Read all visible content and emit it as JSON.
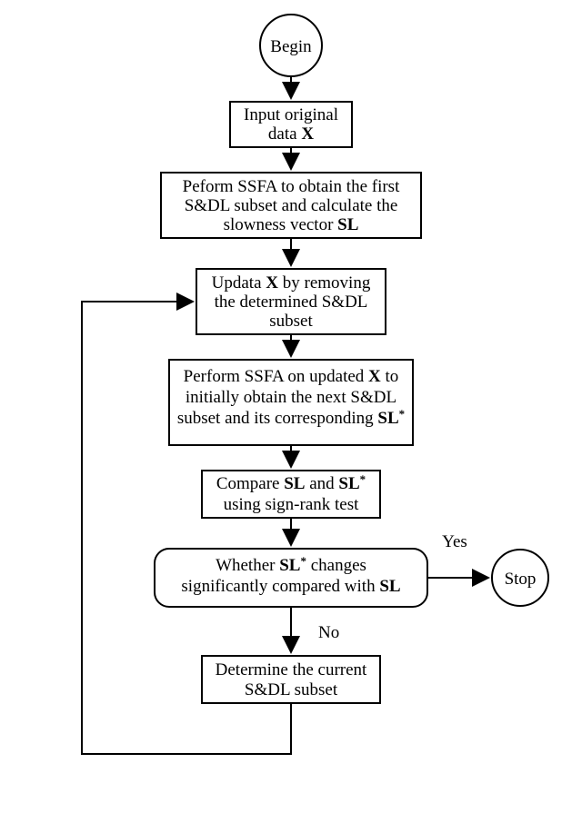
{
  "diagram": {
    "type": "flowchart",
    "nodes": {
      "begin": {
        "kind": "terminator",
        "label": "Begin"
      },
      "input": {
        "kind": "process",
        "lines": [
          "Input original",
          "data X"
        ],
        "bold_tokens": [
          "X"
        ]
      },
      "ssfa_first": {
        "kind": "process",
        "lines": [
          "Peform SSFA to obtain the first",
          "S&DL subset and calculate the",
          "slowness vector SL"
        ],
        "bold_tokens": [
          "SL"
        ]
      },
      "update_x": {
        "kind": "process",
        "lines": [
          "Updata X by removing",
          "the determined S&DL",
          "subset"
        ],
        "bold_tokens": [
          "X"
        ]
      },
      "ssfa_next": {
        "kind": "process",
        "lines": [
          "Perform SSFA on updated X to",
          "initially obtain the next S&DL",
          "subset and its corresponding SL*"
        ],
        "bold_tokens": [
          "X",
          "SL*"
        ]
      },
      "compare": {
        "kind": "process",
        "lines": [
          "Compare SL and SL*",
          "using sign-rank test"
        ],
        "bold_tokens": [
          "SL",
          "SL*"
        ]
      },
      "decision": {
        "kind": "decision",
        "lines": [
          "Whether SL* changes",
          "significantly compared with SL"
        ],
        "bold_tokens": [
          "SL*",
          "SL"
        ]
      },
      "determine": {
        "kind": "process",
        "lines": [
          "Determine the current",
          "S&DL subset"
        ]
      },
      "stop": {
        "kind": "terminator",
        "label": "Stop"
      }
    },
    "edges": [
      {
        "from": "begin",
        "to": "input"
      },
      {
        "from": "input",
        "to": "ssfa_first"
      },
      {
        "from": "ssfa_first",
        "to": "update_x"
      },
      {
        "from": "update_x",
        "to": "ssfa_next"
      },
      {
        "from": "ssfa_next",
        "to": "compare"
      },
      {
        "from": "compare",
        "to": "decision"
      },
      {
        "from": "decision",
        "to": "stop",
        "label": "Yes"
      },
      {
        "from": "decision",
        "to": "determine",
        "label": "No"
      },
      {
        "from": "determine",
        "to": "update_x",
        "loop": true
      }
    ],
    "edge_labels": {
      "yes": "Yes",
      "no": "No"
    }
  }
}
